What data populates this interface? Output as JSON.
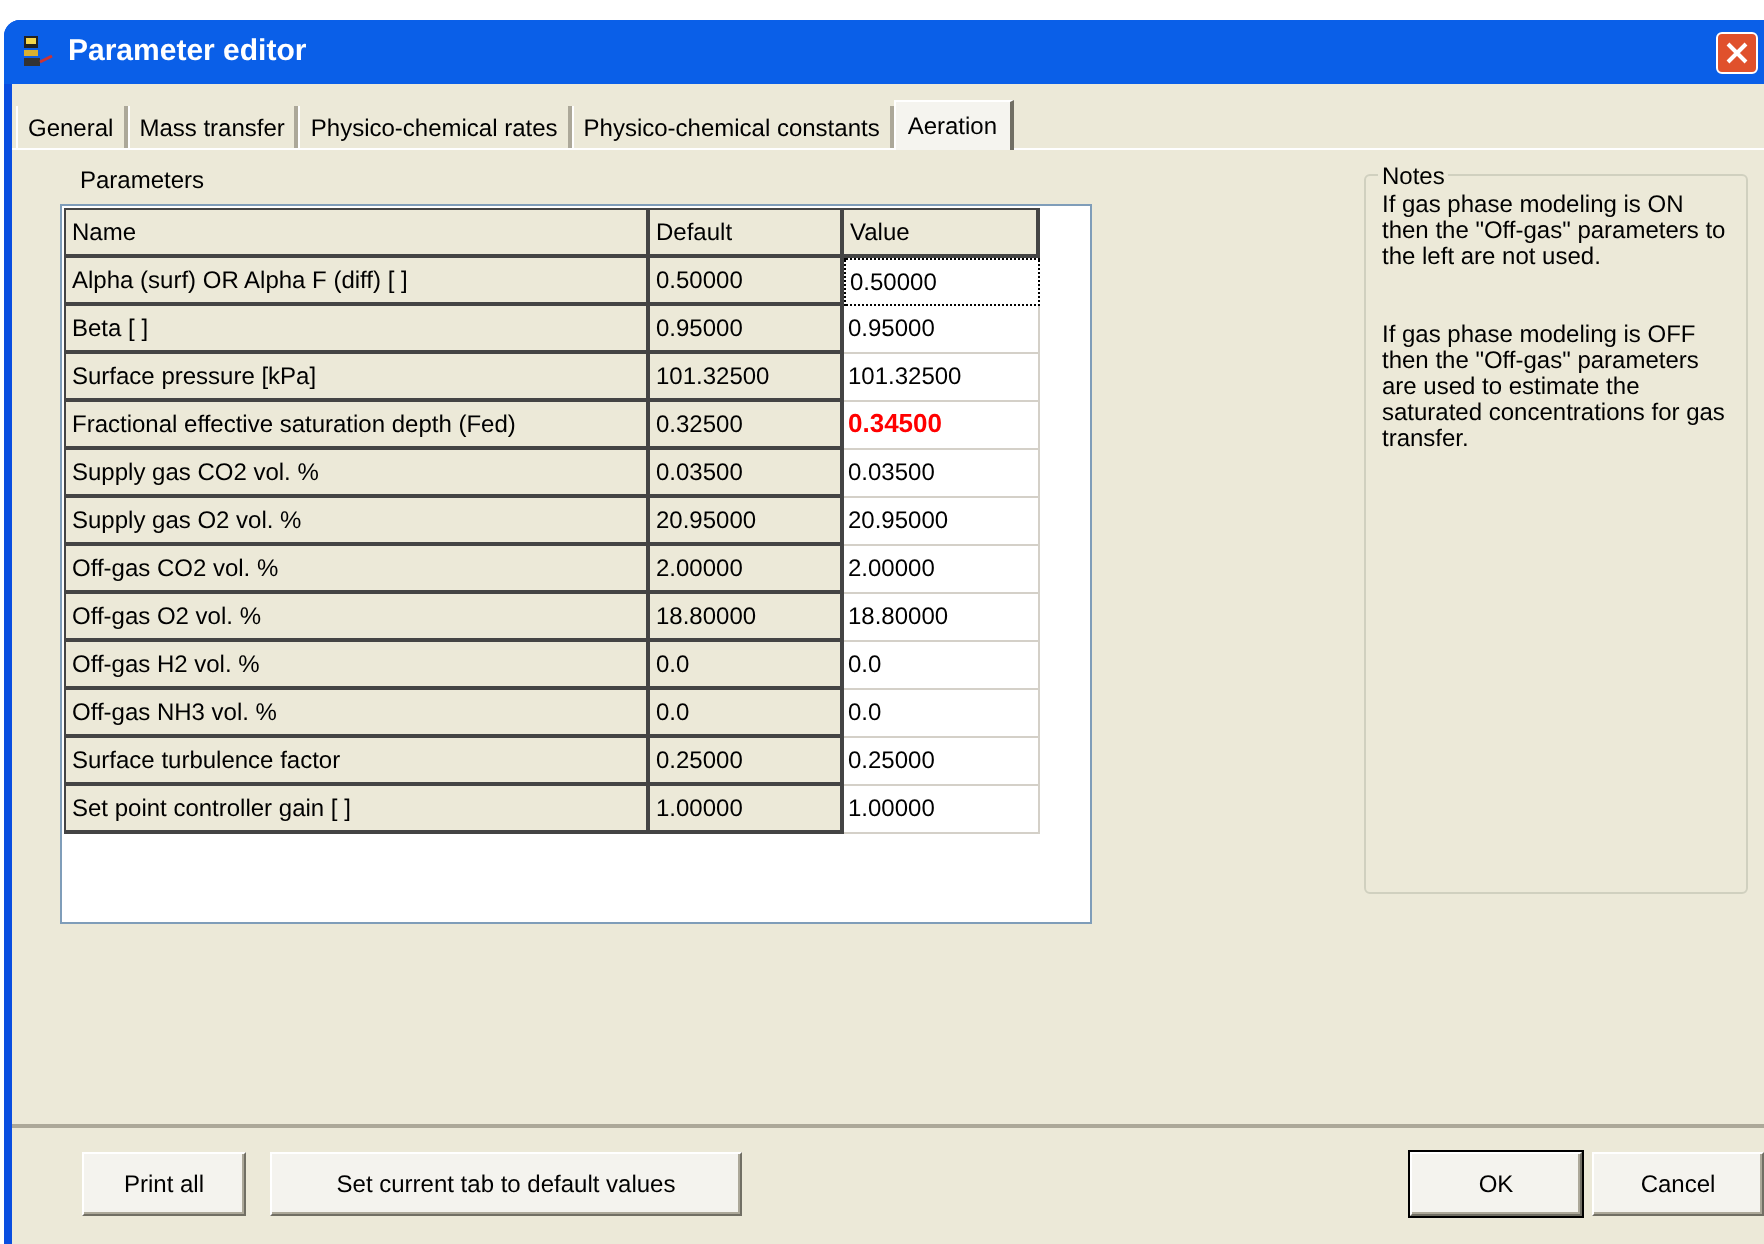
{
  "window": {
    "title": "Parameter editor"
  },
  "tabs": [
    {
      "label": "General",
      "selected": false
    },
    {
      "label": "Mass transfer",
      "selected": false
    },
    {
      "label": "Physico-chemical rates",
      "selected": false
    },
    {
      "label": "Physico-chemical constants",
      "selected": false
    },
    {
      "label": "Aeration",
      "selected": true
    }
  ],
  "parameters": {
    "title": "Parameters",
    "columns": [
      "Name",
      "Default",
      "Value"
    ],
    "rows": [
      {
        "name": "Alpha (surf) OR Alpha F (diff) [ ]",
        "default": "0.50000",
        "value": "0.50000",
        "modified": false,
        "focused": true
      },
      {
        "name": "Beta [ ]",
        "default": "0.95000",
        "value": "0.95000",
        "modified": false,
        "focused": false
      },
      {
        "name": "Surface pressure [kPa]",
        "default": "101.32500",
        "value": "101.32500",
        "modified": false,
        "focused": false
      },
      {
        "name": "Fractional effective saturation depth (Fed)",
        "default": "0.32500",
        "value": "0.34500",
        "modified": true,
        "focused": false
      },
      {
        "name": "Supply gas CO2 vol. %",
        "default": "0.03500",
        "value": "0.03500",
        "modified": false,
        "focused": false
      },
      {
        "name": "Supply gas O2 vol. %",
        "default": "20.95000",
        "value": "20.95000",
        "modified": false,
        "focused": false
      },
      {
        "name": "Off-gas CO2 vol. %",
        "default": "2.00000",
        "value": "2.00000",
        "modified": false,
        "focused": false
      },
      {
        "name": "Off-gas O2 vol. %",
        "default": "18.80000",
        "value": "18.80000",
        "modified": false,
        "focused": false
      },
      {
        "name": "Off-gas H2 vol. %",
        "default": "0.0",
        "value": "0.0",
        "modified": false,
        "focused": false
      },
      {
        "name": "Off-gas NH3 vol. %",
        "default": "0.0",
        "value": "0.0",
        "modified": false,
        "focused": false
      },
      {
        "name": "Surface turbulence factor",
        "default": "0.25000",
        "value": "0.25000",
        "modified": false,
        "focused": false
      },
      {
        "name": "Set point controller gain [ ]",
        "default": "1.00000",
        "value": "1.00000",
        "modified": false,
        "focused": false
      }
    ]
  },
  "notes": {
    "title": "Notes",
    "paragraphs": [
      "If gas phase modeling is ON then the \"Off-gas\" parameters to the left are not used.",
      "If gas phase modeling is OFF then the \"Off-gas\" parameters are used to estimate the saturated concentrations for gas transfer."
    ]
  },
  "buttons_left": [
    "Print all",
    "Set current tab to default values"
  ],
  "buttons_right": [
    {
      "label": "OK",
      "default": true
    },
    {
      "label": "Cancel",
      "default": false
    }
  ]
}
